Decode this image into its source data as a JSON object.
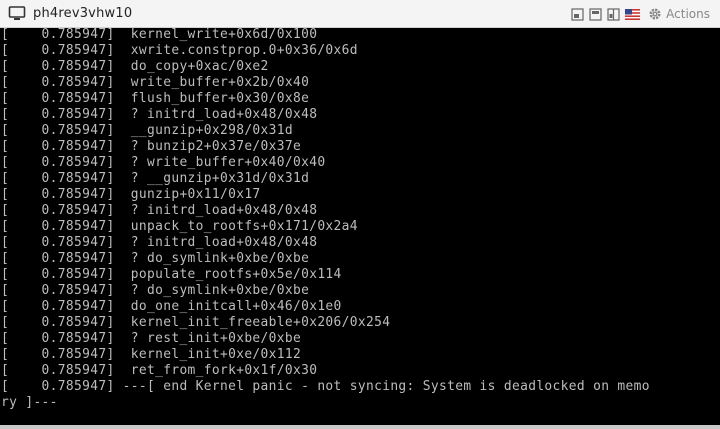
{
  "window": {
    "title": "ph4rev3vhw10",
    "actions_label": "Actions"
  },
  "icons": {
    "monitor": "monitor-icon",
    "fit": "fit-window-icon",
    "single": "single-window-icon",
    "split": "split-window-icon",
    "keyboard_flag": "us-flag-icon",
    "actions": "gear-icon"
  },
  "console": {
    "lines": [
      "[    0.785947]  kernel_write+0x6d/0x100",
      "[    0.785947]  xwrite.constprop.0+0x36/0x6d",
      "[    0.785947]  do_copy+0xac/0xe2",
      "[    0.785947]  write_buffer+0x2b/0x40",
      "[    0.785947]  flush_buffer+0x30/0x8e",
      "[    0.785947]  ? initrd_load+0x48/0x48",
      "[    0.785947]  __gunzip+0x298/0x31d",
      "[    0.785947]  ? bunzip2+0x37e/0x37e",
      "[    0.785947]  ? write_buffer+0x40/0x40",
      "[    0.785947]  ? __gunzip+0x31d/0x31d",
      "[    0.785947]  gunzip+0x11/0x17",
      "[    0.785947]  ? initrd_load+0x48/0x48",
      "[    0.785947]  unpack_to_rootfs+0x171/0x2a4",
      "[    0.785947]  ? initrd_load+0x48/0x48",
      "[    0.785947]  ? do_symlink+0xbe/0xbe",
      "[    0.785947]  populate_rootfs+0x5e/0x114",
      "[    0.785947]  ? do_symlink+0xbe/0xbe",
      "[    0.785947]  do_one_initcall+0x46/0x1e0",
      "[    0.785947]  kernel_init_freeable+0x206/0x254",
      "[    0.785947]  ? rest_init+0xbe/0xbe",
      "[    0.785947]  kernel_init+0xe/0x112",
      "[    0.785947]  ret_from_fork+0x1f/0x30",
      "[    0.785947] ---[ end Kernel panic - not syncing: System is deadlocked on memo",
      "ry ]---"
    ]
  },
  "colors": {
    "terminal_bg": "#000000",
    "terminal_fg": "#bdbdbd",
    "titlebar_bg": "#f4f4f4"
  }
}
